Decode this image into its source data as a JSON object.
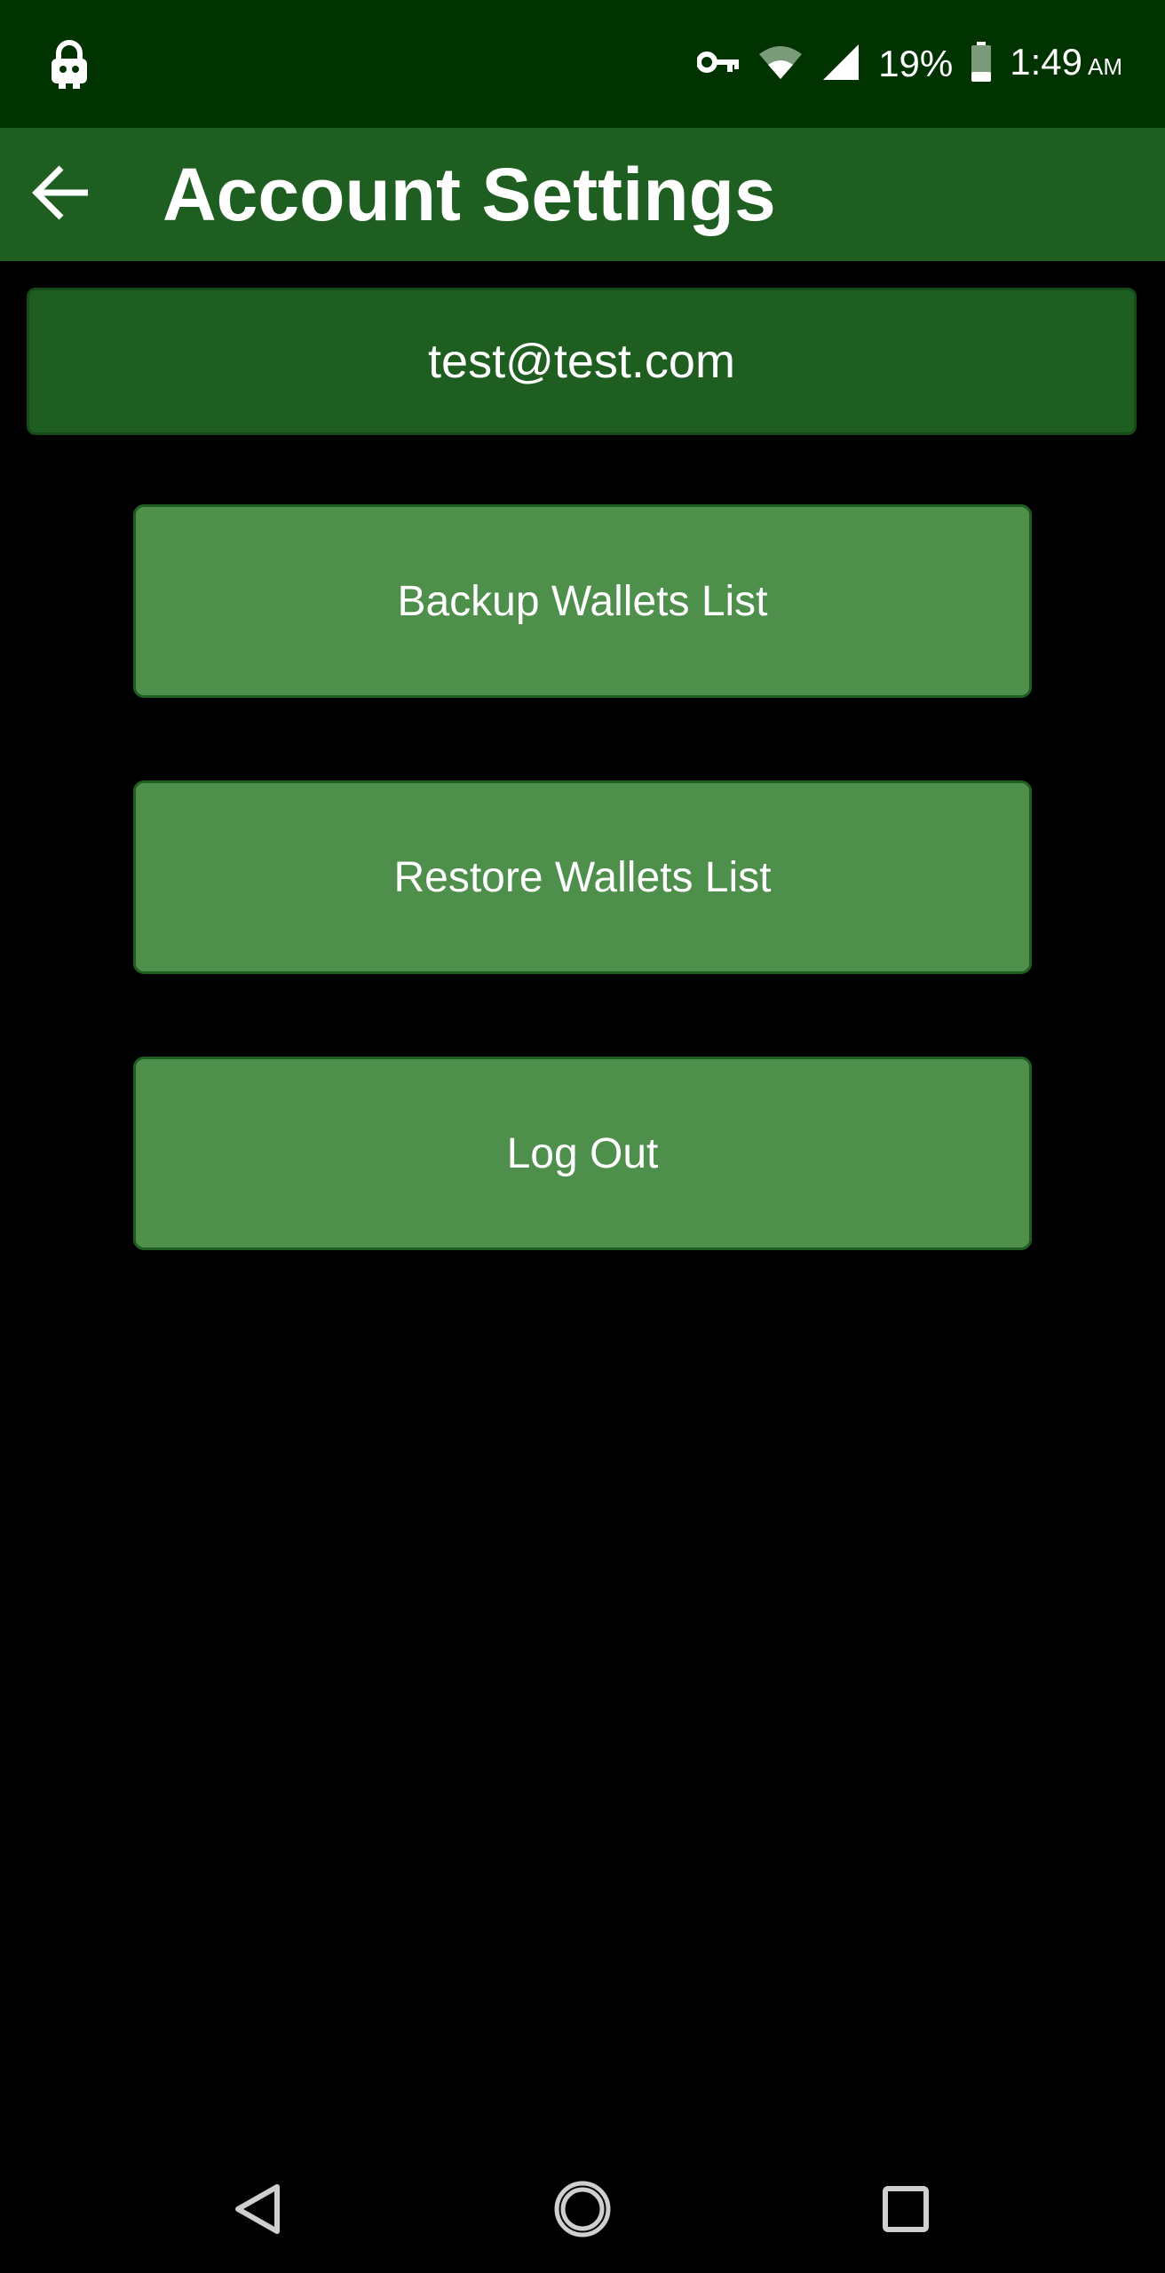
{
  "status_bar": {
    "left_icon": "vpn-lock-icon",
    "icons": [
      "key-icon",
      "wifi-icon",
      "cell-signal-icon"
    ],
    "battery_percent": "19%",
    "battery_icon": "battery-icon",
    "time": "1:49",
    "ampm": "AM"
  },
  "app_bar": {
    "back_icon": "arrow-left-icon",
    "title": "Account Settings"
  },
  "account": {
    "email": "test@test.com"
  },
  "actions": {
    "backup_label": "Backup Wallets List",
    "restore_label": "Restore Wallets List",
    "logout_label": "Log Out"
  },
  "nav_bar": {
    "back_icon": "triangle-back-icon",
    "home_icon": "circle-home-icon",
    "recents_icon": "square-recents-icon"
  },
  "colors": {
    "status_bar_bg": "#003300",
    "app_bar_bg": "#1e5e20",
    "button_bg": "#4e8f4c",
    "background": "#000000",
    "text": "#ffffff"
  }
}
